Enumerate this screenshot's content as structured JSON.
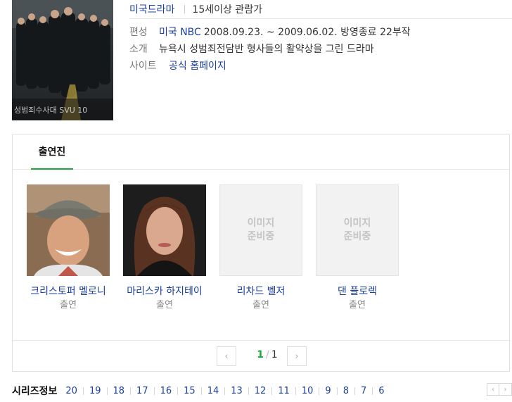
{
  "poster": {
    "caption": "성범죄수사대 SVU 10"
  },
  "info": {
    "genre": "미국드라마",
    "rating": "15세이상 관람가",
    "rows": [
      {
        "label": "편성",
        "channel": "미국 NBC",
        "value": "2008.09.23. ~ 2009.06.02. 방영종료 22부작"
      },
      {
        "label": "소개",
        "value": "뉴욕시 성범죄전담반 형사들의 활약상을 그린 드라마"
      },
      {
        "label": "사이트",
        "link": "공식 홈페이지"
      }
    ]
  },
  "cast": {
    "tab": "출연진",
    "members": [
      {
        "name": "크리스토퍼 멜로니",
        "role": "출연"
      },
      {
        "name": "마리스카 하지테이",
        "role": "출연"
      },
      {
        "name": "리차드 벨저",
        "role": "출연",
        "placeholder": [
          "이미지",
          "준비중"
        ]
      },
      {
        "name": "댄 플로렉",
        "role": "출연",
        "placeholder": [
          "이미지",
          "준비중"
        ]
      }
    ],
    "pager": {
      "current": "1",
      "total": "1",
      "slash": "/"
    }
  },
  "series": {
    "title": "시리즈정보",
    "seasons": [
      "20",
      "19",
      "18",
      "17",
      "16",
      "15",
      "14",
      "13",
      "12",
      "11",
      "10",
      "9",
      "8",
      "7",
      "6"
    ]
  }
}
